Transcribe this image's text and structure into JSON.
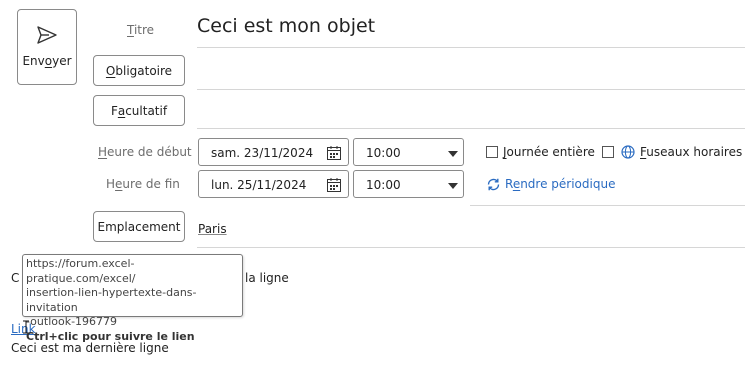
{
  "send": {
    "label_pre": "Env",
    "label_ul": "o",
    "label_post": "yer",
    "icon": "send-icon"
  },
  "title_field": {
    "label_ul": "T",
    "label_rest": "itre",
    "value": "Ceci est mon objet"
  },
  "required_button": {
    "label_ul": "O",
    "label_rest": "bligatoire"
  },
  "optional_button": {
    "label_pre": "F",
    "label_ul": "a",
    "label_rest": "cultatif"
  },
  "start": {
    "label_ul": "H",
    "label_rest": "eure de début",
    "date": "sam. 23/11/2024",
    "time": "10:00"
  },
  "end": {
    "label_pre": "H",
    "label_ul": "e",
    "label_rest": "ure de fin",
    "date": "lun. 25/11/2024",
    "time": "10:00"
  },
  "all_day": {
    "label_ul": "J",
    "label_rest": "ournée entière",
    "checked": false
  },
  "time_zones": {
    "label_ul": "F",
    "label_rest": "useaux horaires",
    "checked": false,
    "icon": "globe-icon"
  },
  "recurrence": {
    "label_pre": "R",
    "label_ul": "e",
    "label_rest": "ndre périodique",
    "icon": "repeat-icon",
    "color": "#2a6bc1"
  },
  "location_button": {
    "label": "Emplacement"
  },
  "location": {
    "value": "Paris"
  },
  "body": {
    "line1_left": "C",
    "line1_right": "la ligne",
    "link_text": "Link",
    "last_line": "Ceci est ma dernière ligne"
  },
  "tooltip": {
    "url_lines": [
      "https://forum.excel-pratique.com/excel/",
      "insertion-lien-hypertexte-dans-invitation",
      "-outlook-196779"
    ],
    "hint": "Ctrl+clic pour suivre le lien"
  }
}
